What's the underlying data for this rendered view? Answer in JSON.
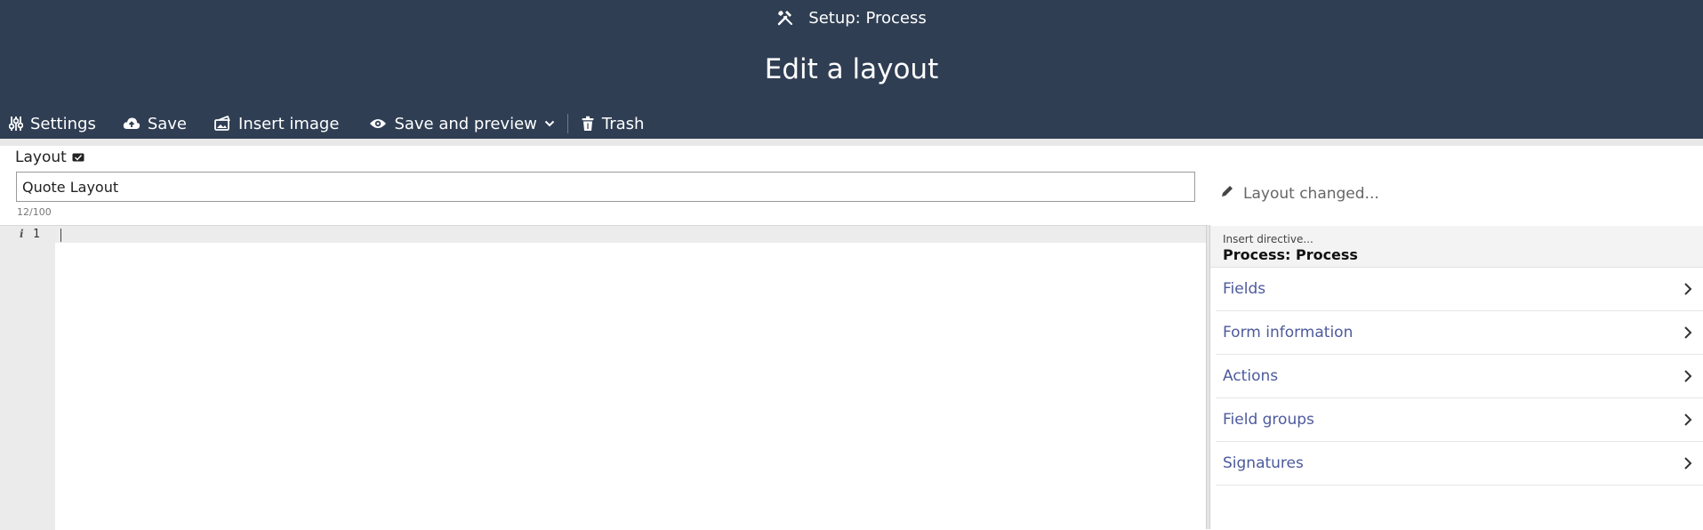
{
  "header": {
    "setup_title": "Setup: Process",
    "page_title": "Edit a layout"
  },
  "toolbar": {
    "settings_label": "Settings",
    "save_label": "Save",
    "insert_image_label": "Insert image",
    "save_preview_label": "Save and preview",
    "trash_label": "Trash"
  },
  "form": {
    "layout_label": "Layout",
    "name_value": "Quote Layout",
    "counter": "12/100",
    "status": "Layout changed..."
  },
  "editor": {
    "line_number": "1",
    "info_glyph": "i"
  },
  "panel": {
    "hint": "Insert directive...",
    "title": "Process: Process",
    "items": [
      {
        "label": "Fields"
      },
      {
        "label": "Form information"
      },
      {
        "label": "Actions"
      },
      {
        "label": "Field groups"
      },
      {
        "label": "Signatures"
      }
    ]
  },
  "colors": {
    "header_bg": "#2f3e53",
    "link": "#4d5a9c"
  }
}
